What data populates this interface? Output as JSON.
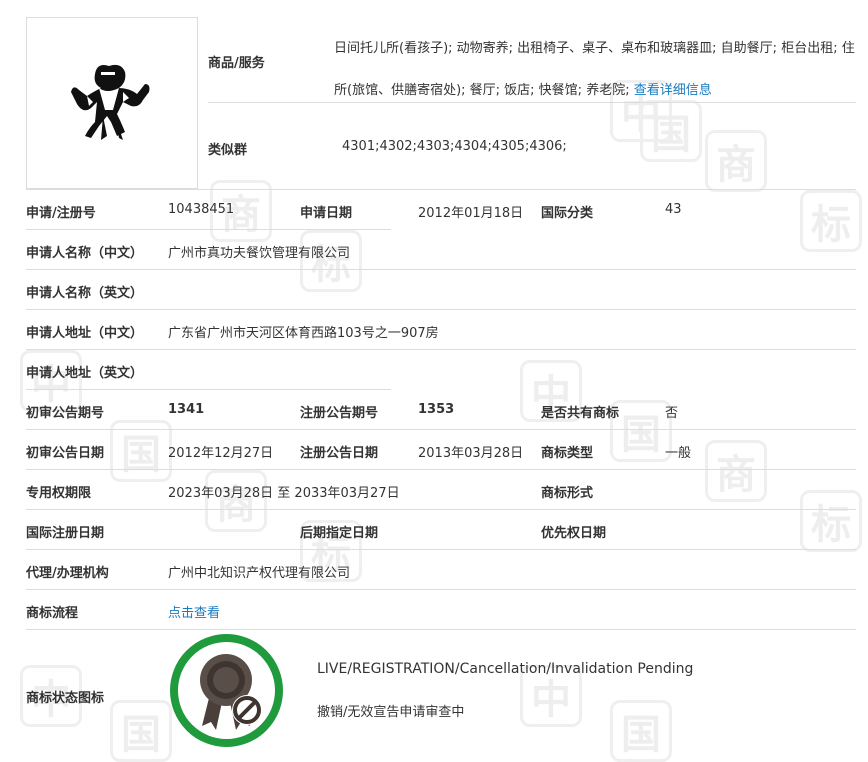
{
  "goods": {
    "label": "商品/服务",
    "text": "日间托儿所(看孩子); 动物寄养; 出租椅子、桌子、桌布和玻璃器皿; 自助餐厅; 柜台出租; 住所(旅馆、供膳寄宿处); 餐厅; 饭店; 快餐馆; 养老院;",
    "more_link": "查看详细信息"
  },
  "similar_group": {
    "label": "类似群",
    "value": "4301;4302;4303;4304;4305;4306;"
  },
  "fields": {
    "reg_no_label": "申请/注册号",
    "reg_no": "10438451",
    "apply_date_label": "申请日期",
    "apply_date": "2012年01月18日",
    "intl_class_label": "国际分类",
    "intl_class": "43",
    "applicant_cn_label": "申请人名称（中文）",
    "applicant_cn": "广州市真功夫餐饮管理有限公司",
    "applicant_en_label": "申请人名称（英文）",
    "applicant_en": "",
    "address_cn_label": "申请人地址（中文）",
    "address_cn": "广东省广州市天河区体育西路103号之一907房",
    "address_en_label": "申请人地址（英文）",
    "address_en": "",
    "prelim_no_label": "初审公告期号",
    "prelim_no": "1341",
    "reg_pub_no_label": "注册公告期号",
    "reg_pub_no": "1353",
    "shared_label": "是否共有商标",
    "shared": "否",
    "prelim_date_label": "初审公告日期",
    "prelim_date": "2012年12月27日",
    "reg_pub_date_label": "注册公告日期",
    "reg_pub_date": "2013年03月28日",
    "tm_type_label": "商标类型",
    "tm_type": "一般",
    "exclusive_label": "专用权期限",
    "exclusive": "2023年03月28日 至 2033年03月27日",
    "tm_form_label": "商标形式",
    "tm_form": "",
    "intl_reg_date_label": "国际注册日期",
    "intl_reg_date": "",
    "later_date_label": "后期指定日期",
    "later_date": "",
    "priority_label": "优先权日期",
    "priority": "",
    "agent_label": "代理/办理机构",
    "agent": "广州中北知识产权代理有限公司",
    "flow_label": "商标流程",
    "flow_link": "点击查看",
    "status_icon_label": "商标状态图标"
  },
  "status": {
    "en": "LIVE/REGISTRATION/Cancellation/Invalidation Pending",
    "cn": "撤销/无效宣告申请审查中",
    "ring_color": "#1f9a3c",
    "icon": "award-ribbon-prohibited-icon"
  },
  "watermark": [
    "中",
    "国",
    "商",
    "标"
  ]
}
